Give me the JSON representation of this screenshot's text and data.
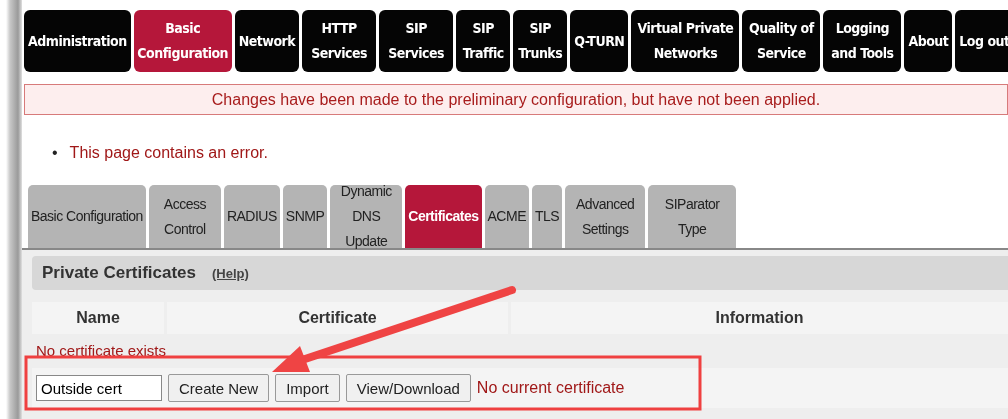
{
  "main_nav": [
    {
      "label": "Administration",
      "selected": false
    },
    {
      "label": "Basic Configuration",
      "selected": true
    },
    {
      "label": "Network",
      "selected": false
    },
    {
      "label": "HTTP Services",
      "selected": false
    },
    {
      "label": "SIP Services",
      "selected": false
    },
    {
      "label": "SIP Traffic",
      "selected": false
    },
    {
      "label": "SIP Trunks",
      "selected": false
    },
    {
      "label": "Q-TURN",
      "selected": false
    },
    {
      "label": "Virtual Private Networks",
      "selected": false
    },
    {
      "label": "Quality of Service",
      "selected": false
    },
    {
      "label": "Logging and Tools",
      "selected": false
    },
    {
      "label": "About",
      "selected": false
    },
    {
      "label": "Log out",
      "selected": false
    }
  ],
  "notice": "Changes have been made to the preliminary configuration, but have not been applied.",
  "errors": [
    {
      "bullet": "•",
      "text": "This page contains an error."
    }
  ],
  "sub_tabs": [
    {
      "label": "Basic Configuration",
      "selected": false
    },
    {
      "label": "Access Control",
      "selected": false
    },
    {
      "label": "RADIUS",
      "selected": false
    },
    {
      "label": "SNMP",
      "selected": false
    },
    {
      "label": "Dynamic DNS Update",
      "selected": false
    },
    {
      "label": "Certificates",
      "selected": true
    },
    {
      "label": "ACME",
      "selected": false
    },
    {
      "label": "TLS",
      "selected": false
    },
    {
      "label": "Advanced Settings",
      "selected": false
    },
    {
      "label": "SIParator Type",
      "selected": false
    }
  ],
  "section": {
    "title": "Private Certificates",
    "help": "(Help)"
  },
  "table": {
    "columns": [
      "Name",
      "Certificate",
      "Information"
    ],
    "empty_message": "No certificate exists",
    "new_row": {
      "name_value": "Outside cert",
      "buttons": [
        "Create New",
        "Import",
        "View/Download"
      ],
      "status": "No current certificate"
    }
  },
  "annotations": [
    {
      "kind": "rectangle"
    },
    {
      "kind": "arrow"
    }
  ]
}
